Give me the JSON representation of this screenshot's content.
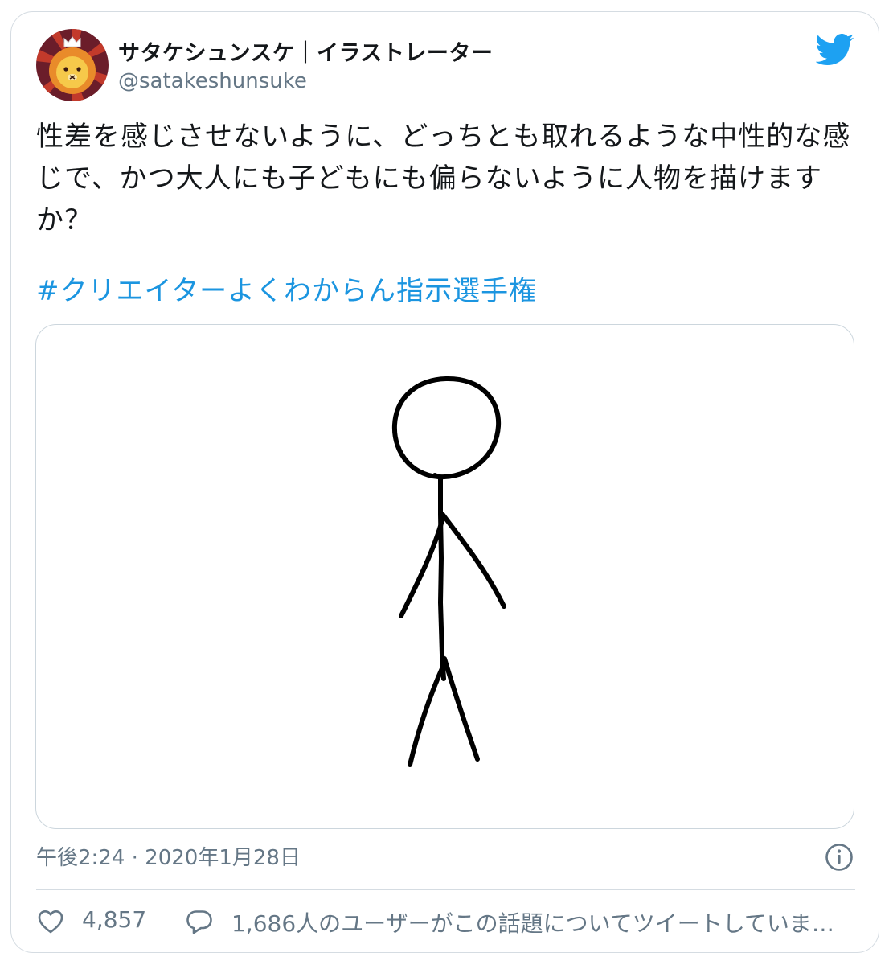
{
  "author": {
    "display_name": "サタケシュンスケ｜イラストレーター",
    "handle": "@satakeshunsuke",
    "avatar_icon": "lion-avatar-icon"
  },
  "tweet": {
    "text": "性差を感じさせないように、どっちとも取れるような中性的な感じで、かつ大人にも子どもにも偏らないように人物を描けますか？",
    "hashtag": "#クリエイターよくわからん指示選手権",
    "timestamp": "午後2:24 · 2020年1月28日"
  },
  "media": {
    "image_icon": "stick-figure-drawing"
  },
  "actions": {
    "like_count": "4,857",
    "conversation_text": "1,686人のユーザーがこの話題についてツイートしていま…"
  },
  "colors": {
    "twitter_blue": "#1da1f2",
    "hashtag_blue": "#1b95e0",
    "secondary_text": "#657786",
    "border": "#d5dce2"
  }
}
